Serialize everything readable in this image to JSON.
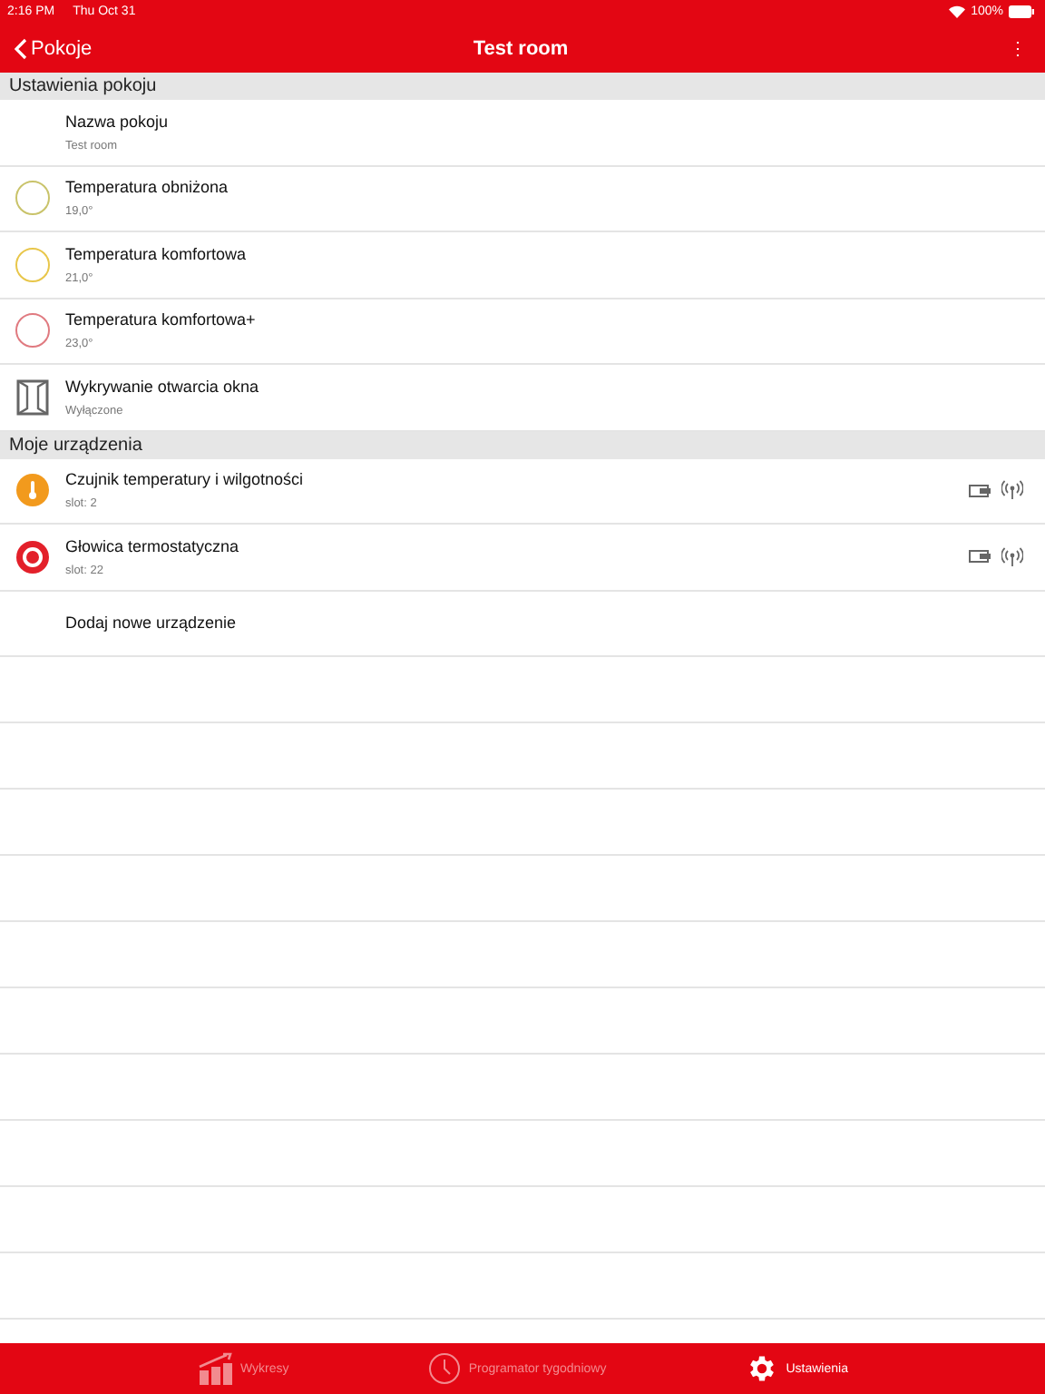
{
  "status_bar": {
    "time": "2:16 PM",
    "date": "Thu Oct 31",
    "battery": "100%"
  },
  "nav": {
    "back": "Pokoje",
    "title": "Test room",
    "menu": "⋮"
  },
  "sections": [
    {
      "title": "Ustawienia pokoju",
      "rows": [
        {
          "kind": "plain",
          "title": "Nazwa pokoju",
          "subtitle": "Test room"
        },
        {
          "kind": "temperature",
          "title": "Temperatura obniżona",
          "subtitle": "19,0°",
          "color": "#c9c36a"
        },
        {
          "kind": "temperature",
          "title": "Temperatura komfortowa",
          "subtitle": "21,0°",
          "color": "#e8c64a"
        },
        {
          "kind": "temperature",
          "title": "Temperatura komfortowa+",
          "subtitle": "23,0°",
          "color": "#e07a80"
        },
        {
          "kind": "window",
          "title": "Wykrywanie otwarcia okna",
          "subtitle": "Wyłączone"
        }
      ]
    },
    {
      "title": "Moje urządzenia",
      "rows": [
        {
          "kind": "sensor",
          "title": "Czujnik temperatury i wilgotności",
          "subtitle": "slot: 2"
        },
        {
          "kind": "thermostat",
          "title": "Głowica termostatyczna",
          "subtitle": "slot: 22"
        },
        {
          "kind": "plain",
          "title": "Dodaj nowe urządzenie"
        }
      ]
    }
  ],
  "tabs": [
    {
      "kind": "charts",
      "label": "Wykresy",
      "selected": false
    },
    {
      "kind": "clock",
      "label": "Programator tygodniowy",
      "selected": false
    },
    {
      "kind": "gear",
      "label": "Ustawienia",
      "selected": true
    }
  ]
}
